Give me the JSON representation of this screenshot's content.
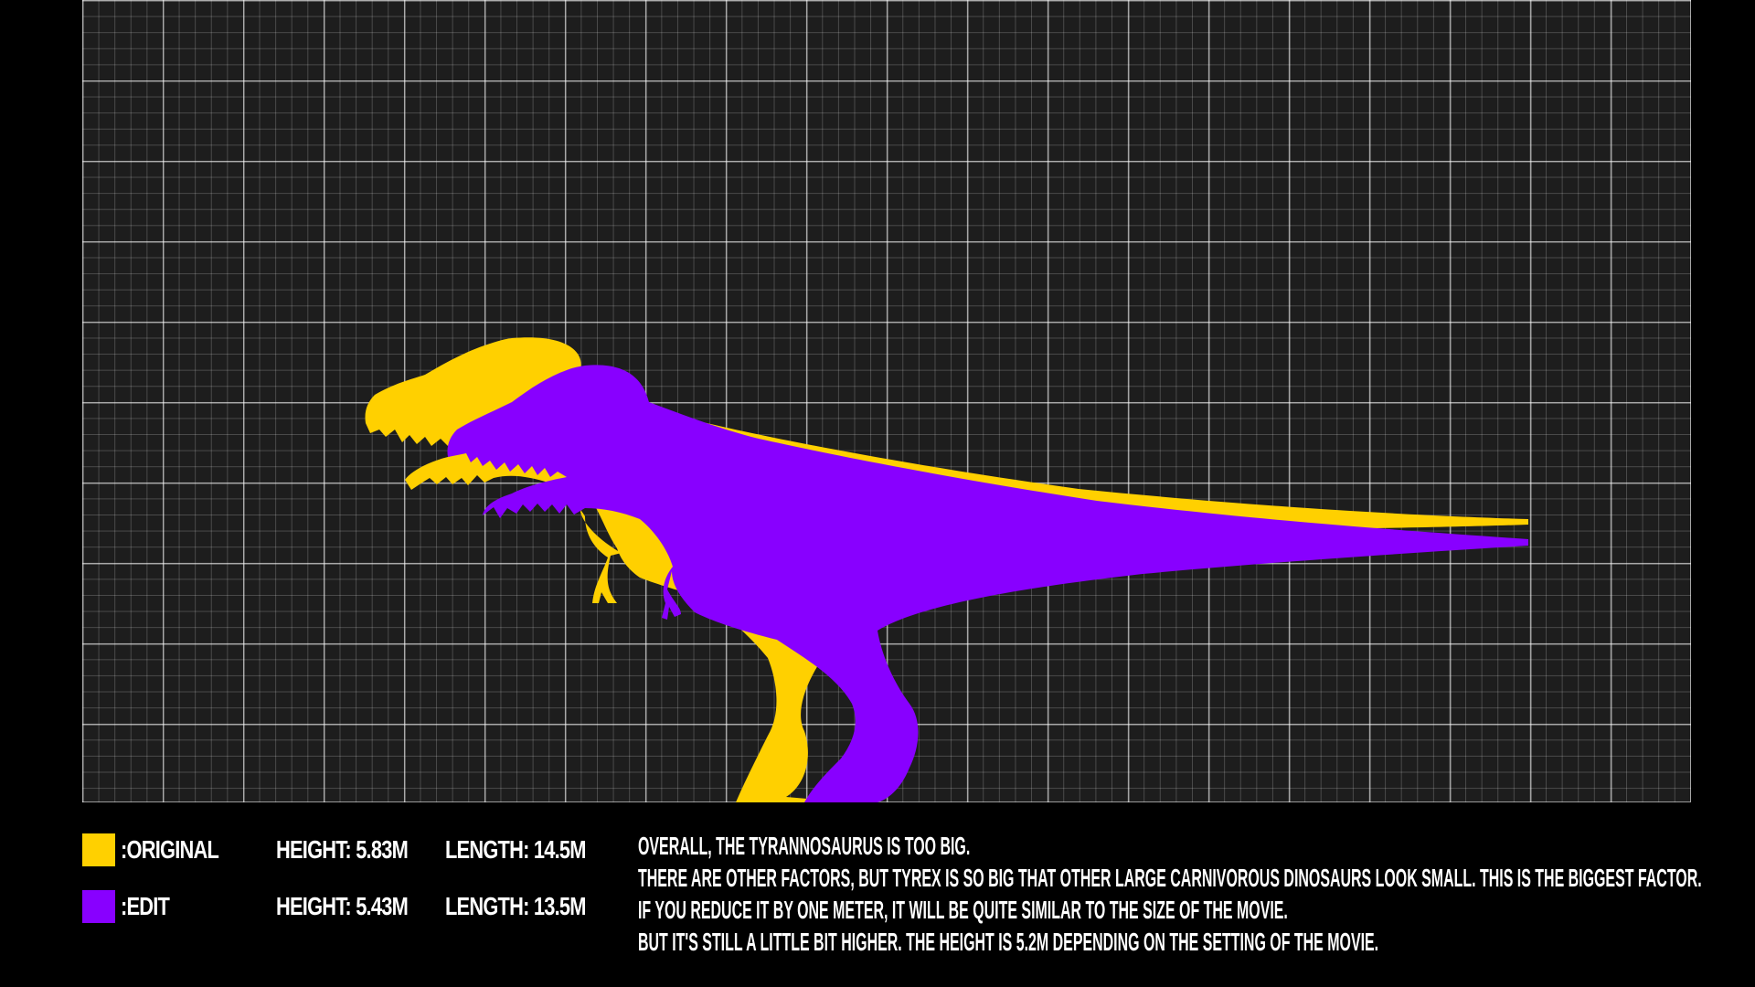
{
  "legend": {
    "original": {
      "label": ":Original",
      "height": "Height: 5.83m",
      "length": "length: 14.5m",
      "color": "#FFD000"
    },
    "edit": {
      "label": ":Edit",
      "height": "Height: 5.43m",
      "length": "length: 13.5m",
      "color": "#8800FF"
    }
  },
  "notes": [
    "Overall, the Tyrannosaurus is too big.",
    "There are other factors, but Tyrex is so big that other large carnivorous dinosaurs look small. This is the biggest factor.",
    "If you reduce it by one meter, it will be quite similar to the size of the movie.",
    "But it's still a little bit higher. The height is 5.2m depending on the setting of the movie."
  ],
  "colors": {
    "background": "#000000",
    "grid_panel": "#1d1d1d",
    "text": "#FFFFFF"
  },
  "icons": [
    "tyrannosaurus-original-silhouette",
    "tyrannosaurus-edit-silhouette"
  ]
}
